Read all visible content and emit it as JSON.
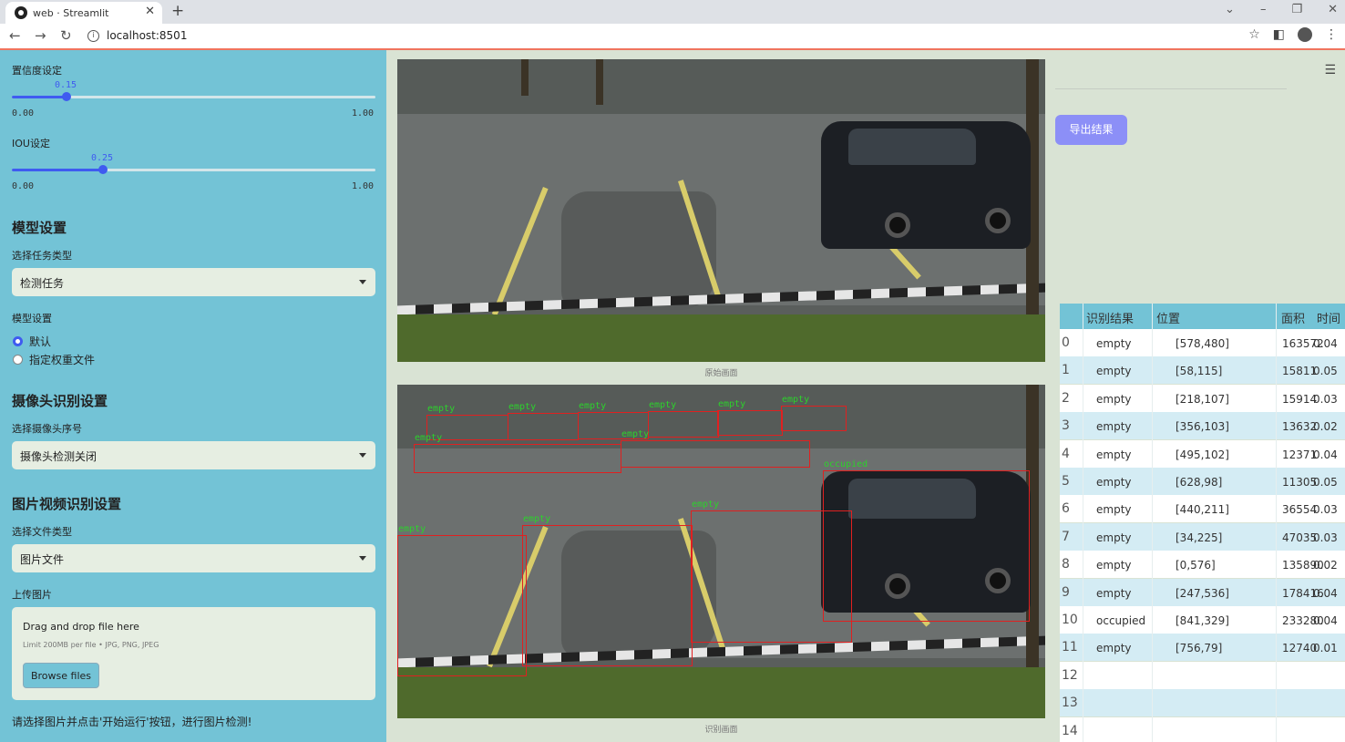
{
  "browser": {
    "tab_title": "web · Streamlit",
    "url": "localhost:8501"
  },
  "sidebar": {
    "conf_label": "置信度设定",
    "conf_value": "0.15",
    "conf_min": "0.00",
    "conf_max": "1.00",
    "conf_fraction": 0.15,
    "iou_label": "IOU设定",
    "iou_value": "0.25",
    "iou_min": "0.00",
    "iou_max": "1.00",
    "iou_fraction": 0.25,
    "model_heading": "模型设置",
    "task_label": "选择任务类型",
    "task_value": "检测任务",
    "model_label": "模型设置",
    "model_options": [
      "默认",
      "指定权重文件"
    ],
    "model_selected": "默认",
    "camera_heading": "摄像头识别设置",
    "camera_label": "选择摄像头序号",
    "camera_value": "摄像头检测关闭",
    "media_heading": "图片视频识别设置",
    "file_type_label": "选择文件类型",
    "file_type_value": "图片文件",
    "upload_label": "上传图片",
    "drop_text": "Drag and drop file here",
    "limit_text": "Limit 200MB per file • JPG, PNG, JPEG",
    "browse_label": "Browse files",
    "hint": "请选择图片并点击'开始运行'按钮，进行图片检测!"
  },
  "main": {
    "original_caption": "原始画面",
    "result_caption": "识别画面",
    "export_label": "导出结果",
    "detections": [
      {
        "label": "empty"
      },
      {
        "label": "empty"
      },
      {
        "label": "empty"
      },
      {
        "label": "empty"
      },
      {
        "label": "empty"
      },
      {
        "label": "empty"
      },
      {
        "label": "empty"
      },
      {
        "label": "empty"
      },
      {
        "label": "empty"
      },
      {
        "label": "empty"
      },
      {
        "label": "empty"
      },
      {
        "label": "occupied"
      }
    ]
  },
  "table": {
    "headers": [
      "识别结果",
      "位置",
      "面积",
      "时间"
    ],
    "rows": [
      {
        "idx": "0",
        "result": "empty",
        "pos": "[578,480]",
        "area": "163572",
        "time": "0.04"
      },
      {
        "idx": "1",
        "result": "empty",
        "pos": "[58,115]",
        "area": "15811",
        "time": "0.05"
      },
      {
        "idx": "2",
        "result": "empty",
        "pos": "[218,107]",
        "area": "15914",
        "time": "0.03"
      },
      {
        "idx": "3",
        "result": "empty",
        "pos": "[356,103]",
        "area": "13632",
        "time": "0.02"
      },
      {
        "idx": "4",
        "result": "empty",
        "pos": "[495,102]",
        "area": "12371",
        "time": "0.04"
      },
      {
        "idx": "5",
        "result": "empty",
        "pos": "[628,98]",
        "area": "11305",
        "time": "0.05"
      },
      {
        "idx": "6",
        "result": "empty",
        "pos": "[440,211]",
        "area": "36554",
        "time": "0.03"
      },
      {
        "idx": "7",
        "result": "empty",
        "pos": "[34,225]",
        "area": "47035",
        "time": "0.03"
      },
      {
        "idx": "8",
        "result": "empty",
        "pos": "[0,576]",
        "area": "135890",
        "time": "0.02"
      },
      {
        "idx": "9",
        "result": "empty",
        "pos": "[247,536]",
        "area": "178416",
        "time": "0.04"
      },
      {
        "idx": "10",
        "result": "occupied",
        "pos": "[841,329]",
        "area": "233280",
        "time": "0.04"
      },
      {
        "idx": "11",
        "result": "empty",
        "pos": "[756,79]",
        "area": "12740",
        "time": "0.01"
      },
      {
        "idx": "12",
        "result": "",
        "pos": "",
        "area": "",
        "time": ""
      },
      {
        "idx": "13",
        "result": "",
        "pos": "",
        "area": "",
        "time": ""
      },
      {
        "idx": "14",
        "result": "",
        "pos": "",
        "area": "",
        "time": ""
      }
    ]
  }
}
